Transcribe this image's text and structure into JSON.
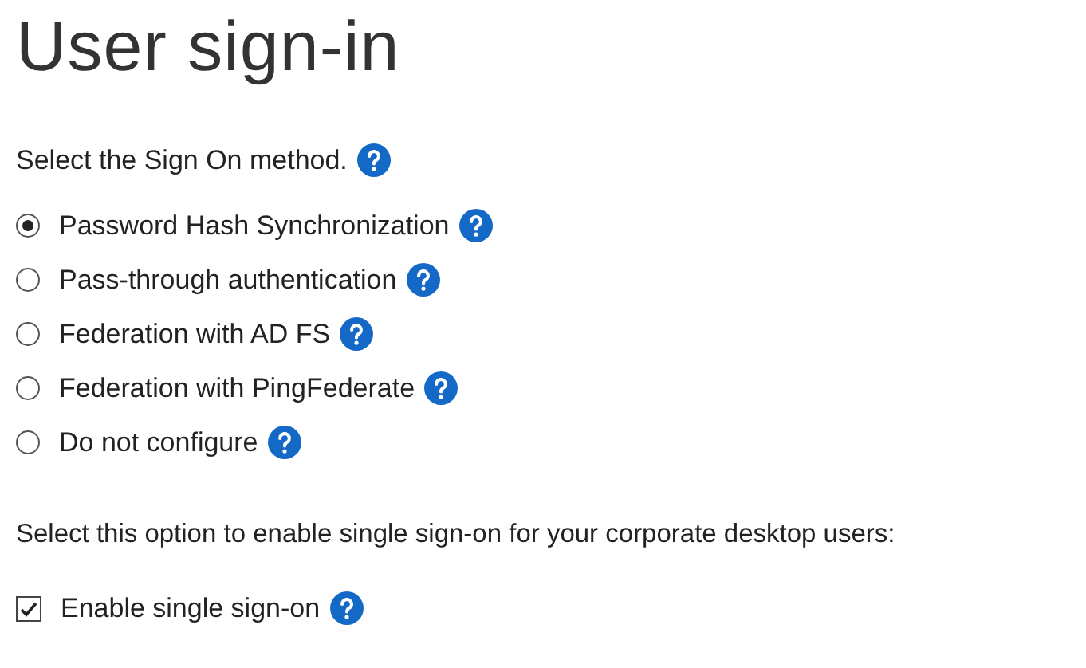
{
  "title": "User sign-in",
  "method_prompt": "Select the Sign On method.",
  "methods": [
    {
      "label": "Password Hash Synchronization",
      "selected": true
    },
    {
      "label": "Pass-through authentication",
      "selected": false
    },
    {
      "label": "Federation with AD FS",
      "selected": false
    },
    {
      "label": "Federation with PingFederate",
      "selected": false
    },
    {
      "label": "Do not configure",
      "selected": false
    }
  ],
  "sso_prompt": "Select this option to enable single sign-on for your corporate desktop users:",
  "sso": {
    "label": "Enable single sign-on",
    "checked": true
  }
}
